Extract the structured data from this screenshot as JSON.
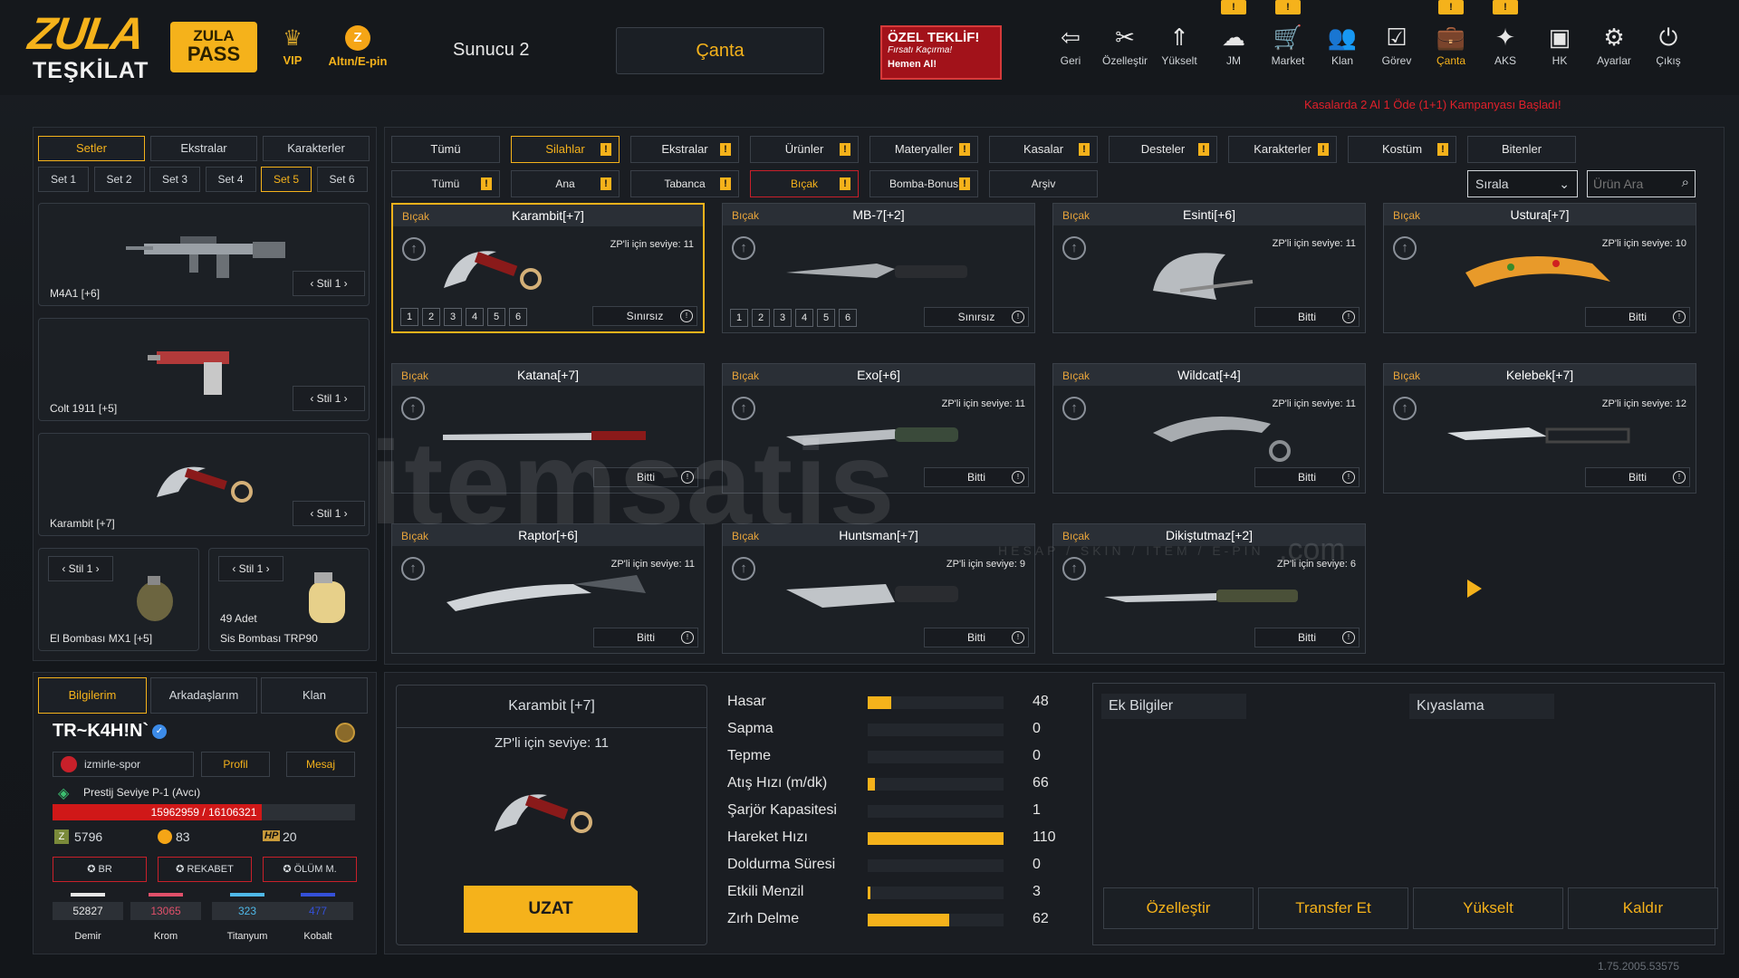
{
  "top": {
    "logo_line1": "ZULA",
    "logo_line2": "TEŞKİLAT",
    "pass_line1": "ZULA",
    "pass_line2": "PASS",
    "vip": "VIP",
    "ep_icon": "Z",
    "epin": "Altın/E-pin",
    "server": "Sunucu 2",
    "bag": "Çanta",
    "offer_title": "ÖZEL TEKLİF!",
    "offer_sub": "Fırsatı Kaçırma!",
    "offer_cta": "Hemen Al!",
    "nav": [
      {
        "label": "Geri",
        "icon": "back-icon"
      },
      {
        "label": "Özelleştir",
        "icon": "tools-icon"
      },
      {
        "label": "Yükselt",
        "icon": "upgrade-icon"
      },
      {
        "label": "JM",
        "icon": "jm-icon",
        "flag": "!"
      },
      {
        "label": "Market",
        "icon": "cart-icon",
        "flag": "!"
      },
      {
        "label": "Klan",
        "icon": "clan-icon"
      },
      {
        "label": "Görev",
        "icon": "task-icon"
      },
      {
        "label": "Çanta",
        "icon": "bag-icon",
        "flag": "!"
      },
      {
        "label": "AKS",
        "icon": "aks-icon",
        "flag": "!"
      },
      {
        "label": "HK",
        "icon": "wallet-icon"
      },
      {
        "label": "Ayarlar",
        "icon": "gear-icon"
      },
      {
        "label": "Çıkış",
        "icon": "power-icon"
      }
    ],
    "campaign": "Kasalarda 2 Al 1 Öde (1+1) Kampanyası Başladı!"
  },
  "left": {
    "tabs": [
      "Setler",
      "Ekstralar",
      "Karakterler"
    ],
    "sets": [
      "Set 1",
      "Set 2",
      "Set 3",
      "Set 4",
      "Set 5",
      "Set 6"
    ],
    "slots": [
      {
        "name": "M4A1 [+6]",
        "stil": "Stil 1"
      },
      {
        "name": "Colt 1911 [+5]",
        "stil": "Stil 1"
      },
      {
        "name": "Karambit [+7]",
        "stil": "Stil 1"
      },
      {
        "name": "El Bombası MX1 [+5]",
        "stil": "Stil 1"
      },
      {
        "name": "Sis Bombası TRP90",
        "stil": "Stil 1",
        "count": "49 Adet"
      }
    ]
  },
  "profile": {
    "tabs": [
      "Bilgilerim",
      "Arkadaşlarım",
      "Klan"
    ],
    "name": "TR~K4H!N`",
    "club": "izmirle-spor",
    "btn_profile": "Profil",
    "btn_message": "Mesaj",
    "prestige": "Prestij Seviye P-1 (Avcı)",
    "xp": "15962959 / 16106321",
    "xp_progress": 0.99,
    "zp": "5796",
    "gold": "83",
    "hp_badge": "HP",
    "hp": "20",
    "modes": [
      "BR",
      "REKABET",
      "ÖLÜM M."
    ],
    "materials": [
      {
        "value": "52827",
        "name": "Demir",
        "color": "#e6e6e6"
      },
      {
        "value": "13065",
        "name": "Krom",
        "color": "#e0506a"
      },
      {
        "value": "323",
        "name": "Titanyum",
        "color": "#4fb8e8"
      },
      {
        "value": "477",
        "name": "Kobalt",
        "color": "#3450d8"
      }
    ]
  },
  "filters": {
    "row1": [
      {
        "label": "Tümü"
      },
      {
        "label": "Silahlar",
        "flag": "!",
        "selected": true
      },
      {
        "label": "Ekstralar",
        "flag": "!"
      },
      {
        "label": "Ürünler",
        "flag": "!"
      },
      {
        "label": "Materyaller",
        "flag": "!"
      },
      {
        "label": "Kasalar",
        "flag": "!"
      },
      {
        "label": "Desteler",
        "flag": "!"
      },
      {
        "label": "Karakterler",
        "flag": "!"
      },
      {
        "label": "Kostüm",
        "flag": "!"
      },
      {
        "label": "Bitenler"
      }
    ],
    "row2": [
      {
        "label": "Tümü",
        "flag": "!"
      },
      {
        "label": "Ana",
        "flag": "!"
      },
      {
        "label": "Tabanca",
        "flag": "!"
      },
      {
        "label": "Bıçak",
        "flag": "!",
        "selected": true
      },
      {
        "label": "Bomba-Bonus",
        "flag": "!"
      },
      {
        "label": "Arşiv"
      }
    ],
    "sort": "Sırala",
    "search_placeholder": "Ürün Ara"
  },
  "items": [
    {
      "cat": "Bıçak",
      "name": "Karambit[+7]",
      "zp": "ZP'li için seviye: 11",
      "status": "Sınırsız",
      "nums": [
        "1",
        "2",
        "3",
        "4",
        "5",
        "6"
      ],
      "selected": true
    },
    {
      "cat": "Bıçak",
      "name": "MB-7[+2]",
      "zp": "",
      "status": "Sınırsız",
      "nums": [
        "1",
        "2",
        "3",
        "4",
        "5",
        "6"
      ]
    },
    {
      "cat": "Bıçak",
      "name": "Esinti[+6]",
      "zp": "ZP'li için seviye: 11",
      "status": "Bitti"
    },
    {
      "cat": "Bıçak",
      "name": "Ustura[+7]",
      "zp": "ZP'li için seviye: 10",
      "status": "Bitti"
    },
    {
      "cat": "Bıçak",
      "name": "Katana[+7]",
      "zp": "",
      "status": "Bitti"
    },
    {
      "cat": "Bıçak",
      "name": "Exo[+6]",
      "zp": "ZP'li için seviye: 11",
      "status": "Bitti"
    },
    {
      "cat": "Bıçak",
      "name": "Wildcat[+4]",
      "zp": "ZP'li için seviye: 11",
      "status": "Bitti"
    },
    {
      "cat": "Bıçak",
      "name": "Kelebek[+7]",
      "zp": "ZP'li için seviye: 12",
      "status": "Bitti"
    },
    {
      "cat": "Bıçak",
      "name": "Raptor[+6]",
      "zp": "ZP'li için seviye: 11",
      "status": "Bitti"
    },
    {
      "cat": "Bıçak",
      "name": "Huntsman[+7]",
      "zp": "ZP'li için seviye: 9",
      "status": "Bitti"
    },
    {
      "cat": "Bıçak",
      "name": "Dikiştutmaz[+2]",
      "zp": "ZP'li için seviye: 6",
      "status": "Bitti"
    }
  ],
  "detail": {
    "name": "Karambit [+7]",
    "zp": "ZP'li için seviye: 11",
    "extend": "UZAT",
    "stats": [
      {
        "label": "Hasar",
        "value": "48",
        "fill": 0.17
      },
      {
        "label": "Sapma",
        "value": "0",
        "fill": 0
      },
      {
        "label": "Tepme",
        "value": "0",
        "fill": 0
      },
      {
        "label": "Atış Hızı (m/dk)",
        "value": "66",
        "fill": 0.05
      },
      {
        "label": "Şarjör Kapasitesi",
        "value": "1",
        "fill": 0
      },
      {
        "label": "Hareket Hızı",
        "value": "110",
        "fill": 1.0
      },
      {
        "label": "Doldurma Süresi",
        "value": "0",
        "fill": 0
      },
      {
        "label": "Etkili Menzil",
        "value": "3",
        "fill": 0.02
      },
      {
        "label": "Zırh Delme",
        "value": "62",
        "fill": 0.6
      }
    ],
    "extra_info": "Ek Bilgiler",
    "compare": "Kıyaslama",
    "actions": [
      "Özelleştir",
      "Transfer Et",
      "Yükselt",
      "Kaldır"
    ]
  },
  "watermark": "itemsatis",
  "watermark_sub": "HESAP / SKIN / ITEM / E-PIN",
  "watermark_dot": ".com",
  "version": "1.75.2005.53575",
  "colors": {
    "accent": "#f5b21b",
    "alert": "#e0202a"
  }
}
